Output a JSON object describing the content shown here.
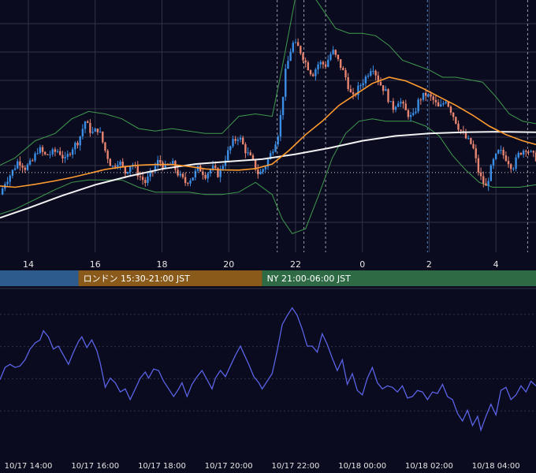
{
  "colors": {
    "background": "#0b0b1f",
    "grid": "#333348",
    "up": "#3a8ee6",
    "down": "#e88570",
    "bands": "#3f9a4f",
    "ma_slow": "#ff9b2f",
    "ma_long": "#f2f2f2",
    "oscillator": "#5a63e6",
    "session_tokyo": "#2e5b8e",
    "session_london": "#8a5a1a",
    "session_ny": "#2e6b45",
    "event_line": "#4a86c8"
  },
  "sessions": [
    {
      "label": "",
      "start": 12.5,
      "end": 15.5,
      "color_key": "session_tokyo"
    },
    {
      "label": "ロンドン 15:30-21:00 JST",
      "start": 15.5,
      "end": 21.0,
      "color_key": "session_london"
    },
    {
      "label": "NY 21:00-06:00 JST",
      "start": 21.0,
      "end": 29.2,
      "color_key": "session_ny"
    }
  ],
  "chart_data": [
    {
      "type": "candlestick",
      "x_unit": "hours (JST, 10/17 00:00 = 0)",
      "x_range": [
        13.15,
        29.2
      ],
      "y_range": [
        0,
        100
      ],
      "x_tick_labels": [
        {
          "x": 14,
          "label": "14"
        },
        {
          "x": 16,
          "label": "16"
        },
        {
          "x": 18,
          "label": "18"
        },
        {
          "x": 20,
          "label": "20"
        },
        {
          "x": 22,
          "label": "22"
        },
        {
          "x": 24,
          "label": "0"
        },
        {
          "x": 26,
          "label": "2"
        },
        {
          "x": 28,
          "label": "4"
        }
      ],
      "vertical_markers": [
        {
          "x": 21.45,
          "style": "dashed"
        },
        {
          "x": 22.25,
          "style": "dashed"
        },
        {
          "x": 22.9,
          "style": "dashed"
        },
        {
          "x": 25.95,
          "style": "dashed-blue"
        },
        {
          "x": 28.95,
          "style": "dashed"
        }
      ],
      "current_price": 31,
      "grid": true,
      "close_points": [
        [
          13.15,
          22
        ],
        [
          13.3,
          27
        ],
        [
          13.5,
          31
        ],
        [
          13.7,
          36
        ],
        [
          13.9,
          33
        ],
        [
          14.1,
          35
        ],
        [
          14.3,
          41
        ],
        [
          14.5,
          38
        ],
        [
          14.7,
          39
        ],
        [
          14.9,
          40
        ],
        [
          15.1,
          36
        ],
        [
          15.3,
          41
        ],
        [
          15.5,
          44
        ],
        [
          15.7,
          52
        ],
        [
          15.9,
          47
        ],
        [
          16.1,
          49
        ],
        [
          16.3,
          40
        ],
        [
          16.5,
          33
        ],
        [
          16.7,
          36
        ],
        [
          16.9,
          31
        ],
        [
          17.1,
          35
        ],
        [
          17.3,
          30
        ],
        [
          17.5,
          27
        ],
        [
          17.7,
          31
        ],
        [
          17.9,
          36
        ],
        [
          18.1,
          33
        ],
        [
          18.3,
          35
        ],
        [
          18.5,
          30
        ],
        [
          18.7,
          27
        ],
        [
          18.9,
          29
        ],
        [
          19.1,
          33
        ],
        [
          19.3,
          30
        ],
        [
          19.5,
          33
        ],
        [
          19.7,
          30
        ],
        [
          19.9,
          37
        ],
        [
          20.1,
          43
        ],
        [
          20.3,
          46
        ],
        [
          20.5,
          40
        ],
        [
          20.7,
          36
        ],
        [
          20.9,
          30
        ],
        [
          21.1,
          34
        ],
        [
          21.3,
          40
        ],
        [
          21.5,
          48
        ],
        [
          21.7,
          72
        ],
        [
          21.9,
          84
        ],
        [
          22.1,
          82
        ],
        [
          22.3,
          76
        ],
        [
          22.5,
          71
        ],
        [
          22.7,
          76
        ],
        [
          22.9,
          75
        ],
        [
          23.1,
          81
        ],
        [
          23.3,
          76
        ],
        [
          23.5,
          70
        ],
        [
          23.7,
          61
        ],
        [
          23.9,
          66
        ],
        [
          24.1,
          70
        ],
        [
          24.3,
          75
        ],
        [
          24.5,
          68
        ],
        [
          24.7,
          64
        ],
        [
          24.9,
          57
        ],
        [
          25.1,
          61
        ],
        [
          25.3,
          56
        ],
        [
          25.5,
          53
        ],
        [
          25.7,
          61
        ],
        [
          25.9,
          63
        ],
        [
          26.1,
          61
        ],
        [
          26.3,
          57
        ],
        [
          26.5,
          61
        ],
        [
          26.7,
          55
        ],
        [
          26.9,
          49
        ],
        [
          27.1,
          45
        ],
        [
          27.3,
          42
        ],
        [
          27.5,
          30
        ],
        [
          27.7,
          25
        ],
        [
          27.9,
          35
        ],
        [
          28.1,
          40
        ],
        [
          28.3,
          37
        ],
        [
          28.5,
          33
        ],
        [
          28.7,
          39
        ],
        [
          28.9,
          41
        ],
        [
          29.1,
          38
        ],
        [
          29.2,
          37
        ]
      ],
      "ma_slow": [
        [
          13.15,
          25.5
        ],
        [
          13.6,
          25.0
        ],
        [
          14.2,
          26.2
        ],
        [
          14.8,
          27.6
        ],
        [
          15.3,
          29.0
        ],
        [
          15.8,
          30.6
        ],
        [
          16.3,
          32.3
        ],
        [
          16.8,
          33.3
        ],
        [
          17.3,
          34.0
        ],
        [
          17.8,
          34.3
        ],
        [
          18.3,
          34.3
        ],
        [
          18.8,
          33.5
        ],
        [
          19.3,
          32.5
        ],
        [
          19.8,
          32.1
        ],
        [
          20.3,
          32.0
        ],
        [
          20.8,
          32.6
        ],
        [
          21.3,
          34.5
        ],
        [
          21.8,
          40.0
        ],
        [
          22.3,
          46.5
        ],
        [
          22.8,
          52.0
        ],
        [
          23.3,
          58.5
        ],
        [
          23.8,
          63.0
        ],
        [
          24.3,
          67.5
        ],
        [
          24.8,
          70.0
        ],
        [
          25.3,
          68.5
        ],
        [
          25.8,
          65.5
        ],
        [
          26.3,
          62.0
        ],
        [
          26.8,
          58.5
        ],
        [
          27.3,
          54.5
        ],
        [
          27.8,
          50.0
        ],
        [
          28.3,
          46.5
        ],
        [
          28.8,
          44.0
        ],
        [
          29.2,
          42.5
        ]
      ],
      "ma_long": [
        [
          13.15,
          12.5
        ],
        [
          14.0,
          16.5
        ],
        [
          15.0,
          21.5
        ],
        [
          16.0,
          26.0
        ],
        [
          17.0,
          29.5
        ],
        [
          18.0,
          32.5
        ],
        [
          19.0,
          34.5
        ],
        [
          20.0,
          35.5
        ],
        [
          21.0,
          36.5
        ],
        [
          22.0,
          38.5
        ],
        [
          23.0,
          41.0
        ],
        [
          24.0,
          44.0
        ],
        [
          25.0,
          46.0
        ],
        [
          26.0,
          47.0
        ],
        [
          27.0,
          47.5
        ],
        [
          28.0,
          47.7
        ],
        [
          29.2,
          47.5
        ]
      ],
      "band_upper": [
        [
          13.15,
          34
        ],
        [
          13.6,
          37
        ],
        [
          14.2,
          44
        ],
        [
          14.8,
          47
        ],
        [
          15.3,
          53
        ],
        [
          15.8,
          56
        ],
        [
          16.3,
          55
        ],
        [
          16.8,
          53
        ],
        [
          17.3,
          49
        ],
        [
          17.8,
          48
        ],
        [
          18.3,
          49
        ],
        [
          18.8,
          48
        ],
        [
          19.3,
          47
        ],
        [
          19.8,
          47
        ],
        [
          20.3,
          54
        ],
        [
          20.8,
          55
        ],
        [
          21.3,
          54
        ],
        [
          21.6,
          74
        ],
        [
          22.0,
          103
        ],
        [
          22.4,
          106
        ],
        [
          22.8,
          98
        ],
        [
          23.2,
          90
        ],
        [
          23.6,
          88
        ],
        [
          24.0,
          88
        ],
        [
          24.4,
          87
        ],
        [
          24.8,
          83
        ],
        [
          25.2,
          77
        ],
        [
          25.6,
          75
        ],
        [
          26.0,
          73
        ],
        [
          26.4,
          70
        ],
        [
          26.8,
          70
        ],
        [
          27.2,
          69
        ],
        [
          27.6,
          68
        ],
        [
          28.0,
          62
        ],
        [
          28.4,
          55
        ],
        [
          28.8,
          52
        ],
        [
          29.2,
          51
        ]
      ],
      "band_lower": [
        [
          13.15,
          14
        ],
        [
          13.6,
          16
        ],
        [
          14.2,
          20
        ],
        [
          14.8,
          24
        ],
        [
          15.3,
          27
        ],
        [
          15.8,
          28
        ],
        [
          16.3,
          28
        ],
        [
          16.8,
          28
        ],
        [
          17.3,
          25
        ],
        [
          17.8,
          23
        ],
        [
          18.3,
          23
        ],
        [
          18.8,
          23
        ],
        [
          19.3,
          22
        ],
        [
          19.8,
          22
        ],
        [
          20.3,
          23
        ],
        [
          20.8,
          27
        ],
        [
          21.3,
          22
        ],
        [
          21.6,
          12
        ],
        [
          21.9,
          6
        ],
        [
          22.3,
          8
        ],
        [
          22.7,
          22
        ],
        [
          23.1,
          37
        ],
        [
          23.5,
          47
        ],
        [
          23.9,
          52
        ],
        [
          24.3,
          53
        ],
        [
          24.7,
          52
        ],
        [
          25.1,
          52
        ],
        [
          25.5,
          52
        ],
        [
          25.9,
          50
        ],
        [
          26.3,
          46
        ],
        [
          26.7,
          38
        ],
        [
          27.1,
          32
        ],
        [
          27.5,
          27
        ],
        [
          27.9,
          25
        ],
        [
          28.3,
          25
        ],
        [
          28.7,
          25
        ],
        [
          29.2,
          26
        ]
      ]
    },
    {
      "type": "line",
      "x_range": [
        13.15,
        29.2
      ],
      "y_range": [
        0,
        100
      ],
      "x_tick_labels": [
        {
          "x": 14,
          "label": "10/17 14:00"
        },
        {
          "x": 16,
          "label": "10/17 16:00"
        },
        {
          "x": 18,
          "label": "10/17 18:00"
        },
        {
          "x": 20,
          "label": "10/17 20:00"
        },
        {
          "x": 22,
          "label": "10/17 22:00"
        },
        {
          "x": 24,
          "label": "10/18 00:00"
        },
        {
          "x": 26,
          "label": "10/18 02:00"
        },
        {
          "x": 28,
          "label": "10/18 04:00"
        }
      ],
      "grid": true,
      "points": [
        [
          13.15,
          44
        ],
        [
          13.3,
          52
        ],
        [
          13.45,
          54
        ],
        [
          13.6,
          52
        ],
        [
          13.75,
          53
        ],
        [
          13.9,
          57
        ],
        [
          14.05,
          64
        ],
        [
          14.2,
          68
        ],
        [
          14.35,
          70
        ],
        [
          14.45,
          76
        ],
        [
          14.6,
          72
        ],
        [
          14.75,
          64
        ],
        [
          14.9,
          66
        ],
        [
          15.05,
          60
        ],
        [
          15.2,
          54
        ],
        [
          15.35,
          62
        ],
        [
          15.5,
          69
        ],
        [
          15.6,
          72
        ],
        [
          15.75,
          65
        ],
        [
          15.9,
          70
        ],
        [
          16.05,
          63
        ],
        [
          16.15,
          55
        ],
        [
          16.3,
          39
        ],
        [
          16.45,
          45
        ],
        [
          16.6,
          42
        ],
        [
          16.75,
          36
        ],
        [
          16.9,
          38
        ],
        [
          17.05,
          31
        ],
        [
          17.2,
          38
        ],
        [
          17.35,
          45
        ],
        [
          17.5,
          49
        ],
        [
          17.6,
          45
        ],
        [
          17.75,
          51
        ],
        [
          17.9,
          50
        ],
        [
          18.05,
          43
        ],
        [
          18.2,
          38
        ],
        [
          18.35,
          33
        ],
        [
          18.5,
          38
        ],
        [
          18.6,
          42
        ],
        [
          18.75,
          33
        ],
        [
          18.9,
          41
        ],
        [
          19.05,
          46
        ],
        [
          19.2,
          50
        ],
        [
          19.35,
          44
        ],
        [
          19.5,
          38
        ],
        [
          19.6,
          45
        ],
        [
          19.75,
          50
        ],
        [
          19.9,
          46
        ],
        [
          20.05,
          53
        ],
        [
          20.2,
          60
        ],
        [
          20.35,
          66
        ],
        [
          20.45,
          61
        ],
        [
          20.6,
          54
        ],
        [
          20.75,
          46
        ],
        [
          20.9,
          42
        ],
        [
          21.0,
          38
        ],
        [
          21.15,
          43
        ],
        [
          21.3,
          48
        ],
        [
          21.45,
          63
        ],
        [
          21.6,
          80
        ],
        [
          21.75,
          86
        ],
        [
          21.9,
          91
        ],
        [
          22.05,
          86
        ],
        [
          22.2,
          77
        ],
        [
          22.35,
          66
        ],
        [
          22.5,
          66
        ],
        [
          22.65,
          62
        ],
        [
          22.8,
          74
        ],
        [
          22.95,
          67
        ],
        [
          23.1,
          58
        ],
        [
          23.25,
          50
        ],
        [
          23.4,
          57
        ],
        [
          23.55,
          41
        ],
        [
          23.7,
          48
        ],
        [
          23.85,
          37
        ],
        [
          24.0,
          34
        ],
        [
          24.15,
          45
        ],
        [
          24.3,
          52
        ],
        [
          24.45,
          42
        ],
        [
          24.6,
          38
        ],
        [
          24.75,
          40
        ],
        [
          24.9,
          39
        ],
        [
          25.05,
          36
        ],
        [
          25.2,
          40
        ],
        [
          25.35,
          32
        ],
        [
          25.5,
          33
        ],
        [
          25.65,
          37
        ],
        [
          25.8,
          36
        ],
        [
          25.95,
          31
        ],
        [
          26.1,
          36
        ],
        [
          26.25,
          35
        ],
        [
          26.4,
          41
        ],
        [
          26.55,
          33
        ],
        [
          26.7,
          31
        ],
        [
          26.85,
          22
        ],
        [
          27.0,
          17
        ],
        [
          27.15,
          24
        ],
        [
          27.3,
          14
        ],
        [
          27.45,
          20
        ],
        [
          27.55,
          11
        ],
        [
          27.7,
          20
        ],
        [
          27.85,
          28
        ],
        [
          28.0,
          21
        ],
        [
          28.15,
          37
        ],
        [
          28.3,
          39
        ],
        [
          28.45,
          31
        ],
        [
          28.6,
          34
        ],
        [
          28.75,
          40
        ],
        [
          28.9,
          36
        ],
        [
          29.05,
          43
        ],
        [
          29.2,
          40
        ]
      ]
    }
  ]
}
